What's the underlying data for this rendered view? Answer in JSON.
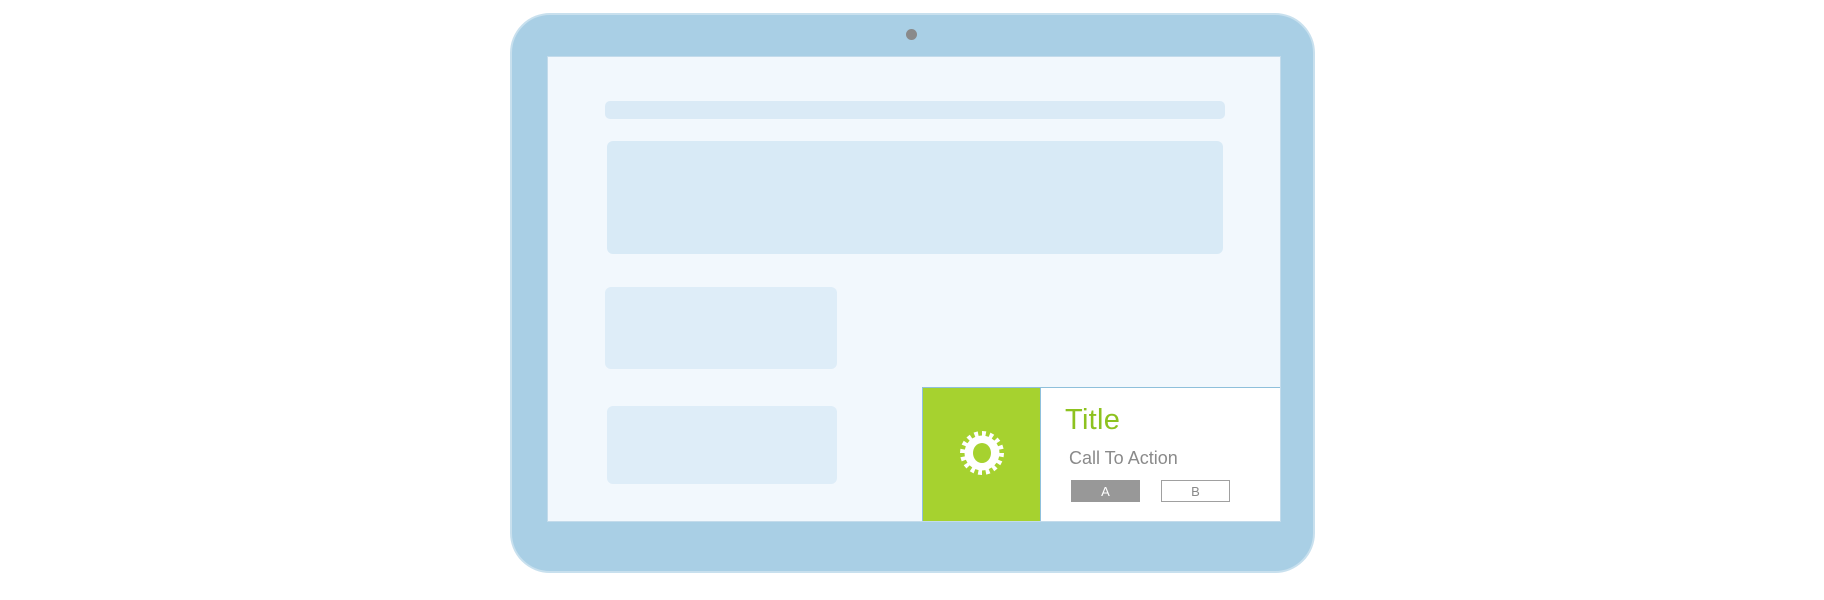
{
  "device": {
    "type": "tablet",
    "frame_color": "#a9cfe5",
    "screen_color": "#f2f8fd"
  },
  "notification": {
    "icon": "gear-icon",
    "accent_color": "#a6d22f",
    "title": "Title",
    "call_to_action": "Call To Action",
    "buttons": [
      {
        "label": "A",
        "style": "filled"
      },
      {
        "label": "B",
        "style": "outline"
      }
    ]
  }
}
